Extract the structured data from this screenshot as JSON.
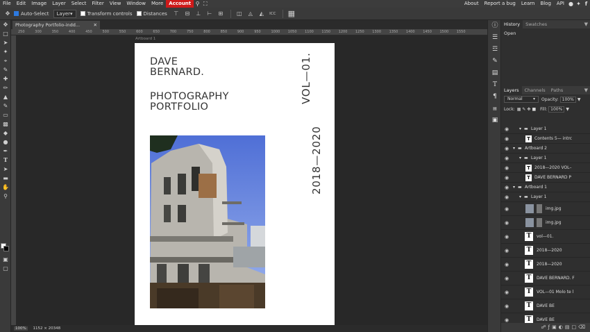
{
  "menu": {
    "items": [
      "File",
      "Edit",
      "Image",
      "Layer",
      "Select",
      "Filter",
      "View",
      "Window",
      "More",
      "Account"
    ],
    "right_items": [
      "About",
      "Report a bug",
      "Learn",
      "Blog",
      "API"
    ]
  },
  "options": {
    "auto_select_label": "Auto-Select",
    "auto_select_checked": true,
    "target_value": "Layer",
    "transform_label": "Transform controls",
    "distances_label": "Distances"
  },
  "document": {
    "tab_title": "Photography Portfolio-indd...",
    "artboard_label": "Artboard 1",
    "name_lines": [
      "DAVE",
      "BERNARD."
    ],
    "subtitle_lines": [
      "PHOTOGRAPHY",
      "PORTFOLIO"
    ],
    "vol_text": "VOL—01.",
    "years_text": "2018—2020"
  },
  "ruler_ticks": [
    "250",
    "300",
    "350",
    "400",
    "450",
    "500",
    "550",
    "600",
    "650",
    "700",
    "750",
    "800",
    "850",
    "900",
    "950",
    "1000",
    "1050",
    "1100",
    "1150",
    "1200",
    "1250",
    "1300",
    "1350",
    "1400",
    "1450",
    "1500",
    "1550"
  ],
  "status": {
    "zoom": "100%",
    "size": "1152 × 20348"
  },
  "panels": {
    "history_tabs": [
      "History",
      "Swatches"
    ],
    "history_items": [
      "Open"
    ],
    "layer_tabs": [
      "Layers",
      "Channels",
      "Paths"
    ],
    "blend_mode": "Normal",
    "opacity_label": "Opacity:",
    "opacity_value": "100%",
    "lock_label": "Lock:",
    "fill_label": "Fill:",
    "fill_value": "100%",
    "layers": [
      {
        "type": "folder",
        "indent": 2,
        "name": "Layer 1"
      },
      {
        "type": "text",
        "indent": 3,
        "name": "Contents 5— intrc"
      },
      {
        "type": "folder",
        "indent": 1,
        "name": "Artboard 2"
      },
      {
        "type": "folder",
        "indent": 2,
        "name": "Layer 1"
      },
      {
        "type": "text",
        "indent": 3,
        "name": "2018—2020 VOL–"
      },
      {
        "type": "text",
        "indent": 3,
        "name": "DAVE BERNARD P"
      },
      {
        "type": "folder",
        "indent": 1,
        "name": "Artboard 1"
      },
      {
        "type": "folder",
        "indent": 2,
        "name": "Layer 1"
      },
      {
        "type": "image",
        "indent": 3,
        "name": "img.jpg"
      },
      {
        "type": "image",
        "indent": 3,
        "name": "img.jpg"
      },
      {
        "type": "textbig",
        "indent": 2,
        "name": "vol—01."
      },
      {
        "type": "textbig",
        "indent": 2,
        "name": "2018—2020"
      },
      {
        "type": "textbig",
        "indent": 2,
        "name": "2018—2020"
      },
      {
        "type": "textbig",
        "indent": 2,
        "name": "DAVE BERNARD. F"
      },
      {
        "type": "textbig",
        "indent": 2,
        "name": "VOL—01 Molo te l"
      },
      {
        "type": "textbig",
        "indent": 2,
        "name": "DAVE BE"
      },
      {
        "type": "textbig",
        "indent": 2,
        "name": "DAVE BE"
      }
    ]
  }
}
